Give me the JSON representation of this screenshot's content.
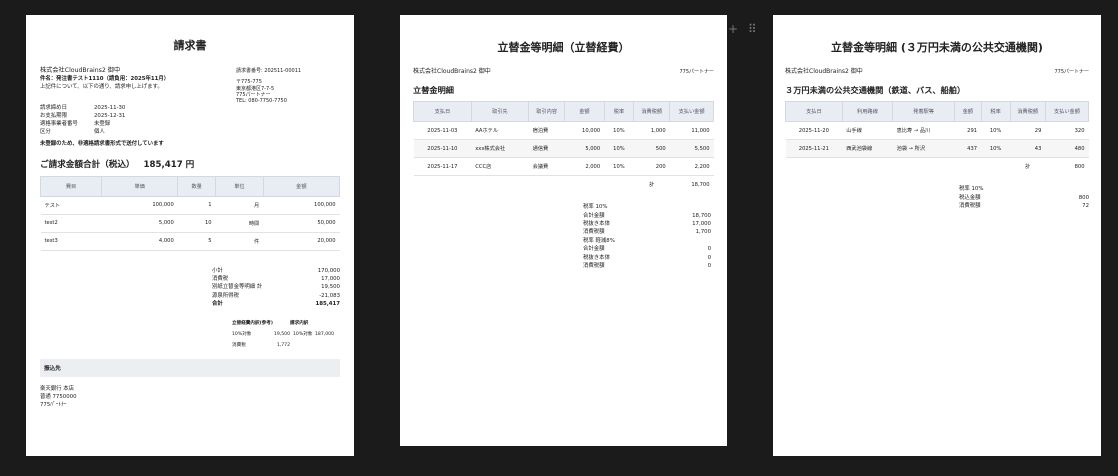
{
  "invoice": {
    "title": "請求書",
    "recipient": "株式会社CloudBrains2 御中",
    "subject": "件名：発注書テスト1110（請負用：2025年11月）",
    "message": "上記件について、以下の通り、請求申し上げます。",
    "invoice_no": "請求書番号: 202511-00011",
    "issuer_lines": [
      "〒775-775",
      "東京都港区7-7-5",
      "775パートナー",
      "TEL: 080-7750-7750"
    ],
    "meta": [
      {
        "label": "請求締め日",
        "value": "2025-11-30"
      },
      {
        "label": "お支払期限",
        "value": "2025-12-31"
      },
      {
        "label": "適格事業者番号",
        "value": "未登録"
      },
      {
        "label": "区分",
        "value": "個人"
      }
    ],
    "notice": "未登録のため、非適格請求書形式で送付しています",
    "total_label": "ご請求金額合計（税込）",
    "total_value": "185,417 円",
    "headers": [
      "費目",
      "単価",
      "数量",
      "単位",
      "金額"
    ],
    "rows": [
      [
        "テスト",
        "100,000",
        "1",
        "月",
        "100,000"
      ],
      [
        "test2",
        "5,000",
        "10",
        "時間",
        "50,000"
      ],
      [
        "test3",
        "4,000",
        "5",
        "件",
        "20,000"
      ]
    ],
    "summary": [
      {
        "label": "小計",
        "value": "170,000"
      },
      {
        "label": "消費税",
        "value": "17,000"
      },
      {
        "label": "別紙立替金等明細 計",
        "value": "19,500"
      },
      {
        "label": "源泉所得税",
        "value": "-21,083"
      },
      {
        "label": "合計",
        "value": "185,417"
      }
    ],
    "tax_ref_head": "立替経費内訳(参考)",
    "tax_ref_head2": "請求内訳",
    "tax_ref_row1": [
      "10%対象",
      "19,500",
      "10%対象",
      "187,000"
    ],
    "tax_ref_row2": [
      "消費税",
      "1,772"
    ],
    "bank_head": "振込先",
    "bank_lines": [
      "楽天銀行 本店",
      "普通 7750000",
      "775ﾊﾟｰﾄﾅｰ"
    ]
  },
  "expenses": {
    "title": "立替金等明細（立替経費）",
    "recipient": "株式会社CloudBrains2 御中",
    "issuer": "775パートナー",
    "section": "立替金明細",
    "headers": [
      "支払日",
      "取引先",
      "取引内容",
      "金額",
      "税率",
      "消費税額",
      "支払い金額"
    ],
    "rows": [
      [
        "2025-11-03",
        "AAホテル",
        "宿泊費",
        "10,000",
        "10%",
        "1,000",
        "11,000"
      ],
      [
        "2025-11-10",
        "xxx株式会社",
        "通信費",
        "5,000",
        "10%",
        "500",
        "5,500"
      ],
      [
        "2025-11-17",
        "CCC店",
        "会議費",
        "2,000",
        "10%",
        "200",
        "2,200"
      ]
    ],
    "total_label": "計",
    "total_value": "18,700",
    "breakdown": [
      {
        "label": "税率 10%",
        "value": ""
      },
      {
        "label": "合計金額",
        "value": "18,700"
      },
      {
        "label": "税抜き本体",
        "value": "17,000"
      },
      {
        "label": "消費税額",
        "value": "1,700"
      },
      {
        "label": "税率 軽減8%",
        "value": ""
      },
      {
        "label": "合計金額",
        "value": "0"
      },
      {
        "label": "税抜き本体",
        "value": "0"
      },
      {
        "label": "消費税額",
        "value": "0"
      }
    ]
  },
  "transit": {
    "title": "立替金等明細 (３万円未満の公共交通機関)",
    "recipient": "株式会社CloudBrains2 御中",
    "issuer": "775パートナー",
    "section": "３万円未満の公共交通機関（鉄道、バス、船舶）",
    "headers": [
      "支払日",
      "利用路線",
      "発着駅等",
      "金額",
      "税率",
      "消費税額",
      "支払い金額"
    ],
    "rows": [
      [
        "2025-11-20",
        "山手線",
        "恵比寿 → 品川",
        "291",
        "10%",
        "29",
        "320"
      ],
      [
        "2025-11-21",
        "西武池袋線",
        "池袋 → 所沢",
        "437",
        "10%",
        "43",
        "480"
      ]
    ],
    "total_label": "計",
    "total_value": "800",
    "breakdown": [
      {
        "label": "税率 10%",
        "value": ""
      },
      {
        "label": "税込金額",
        "value": "800"
      },
      {
        "label": "消費税額",
        "value": "72"
      }
    ]
  },
  "toolbar": {
    "plus": "+",
    "grip": "⠿"
  }
}
